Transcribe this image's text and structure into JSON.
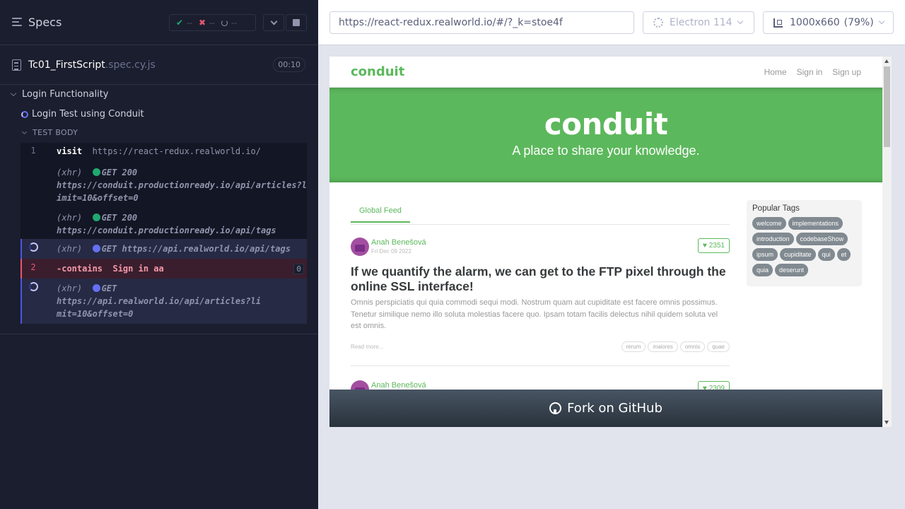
{
  "reporter": {
    "title": "Specs",
    "stats": {
      "passed": "--",
      "failed": "--",
      "pending": "--"
    },
    "spec": {
      "name": "Tc01_FirstScript",
      "ext": ".spec.cy.js",
      "duration": "00:10"
    },
    "suite": "Login Functionality",
    "test": "Login Test using Conduit",
    "body_label": "TEST BODY",
    "commands": [
      {
        "num": "1",
        "name": "visit",
        "message": "https://react-redux.realworld.io/"
      },
      {
        "xhr": "(xhr)",
        "method": "GET 200",
        "url": "https://conduit.productionready.io/api/articles?limit=10&offset=0"
      },
      {
        "xhr": "(xhr)",
        "method": "GET 200",
        "url": "https://conduit.productionready.io/api/tags"
      },
      {
        "xhr": "(xhr)",
        "method": "GET",
        "url": "https://api.realworld.io/api/tags"
      },
      {
        "num": "2",
        "name": "-contains",
        "message": "Sign in aa",
        "count": "0"
      },
      {
        "xhr": "(xhr)",
        "method": "GET",
        "url": "https://api.realworld.io/api/articles?limit=10&offset=0"
      }
    ]
  },
  "aut_header": {
    "url": "https://react-redux.realworld.io/#/?_k=stoe4f",
    "browser": "Electron 114",
    "viewport": "1000x660",
    "scale": "(79%)"
  },
  "app": {
    "brand": "conduit",
    "nav": {
      "home": "Home",
      "signin": "Sign in",
      "signup": "Sign up"
    },
    "banner_title": "conduit",
    "banner_subtitle": "A place to share your knowledge.",
    "feed_tab": "Global Feed",
    "articles": [
      {
        "author": "Anah Benešová",
        "date": "Fri Dec 09 2022",
        "likes": "2351",
        "title": "If we quantify the alarm, we can get to the FTP pixel through the online SSL interface!",
        "description": "Omnis perspiciatis qui quia commodi sequi modi. Nostrum quam aut cupiditate est facere omnis possimus. Tenetur similique nemo illo soluta molestias facere quo. Ipsam totam facilis delectus nihil quidem soluta vel est omnis.",
        "read_more": "Read more...",
        "tags": [
          "rerum",
          "maiores",
          "omnis",
          "quae"
        ]
      },
      {
        "author": "Anah Benešová",
        "likes": "2309"
      }
    ],
    "popular_tags_title": "Popular Tags",
    "popular_tags": [
      "welcome",
      "implementations",
      "introduction",
      "codebaseShow",
      "ipsum",
      "cupiditate",
      "qui",
      "et",
      "quia",
      "deserunt"
    ],
    "fork_text": "Fork on GitHub"
  }
}
